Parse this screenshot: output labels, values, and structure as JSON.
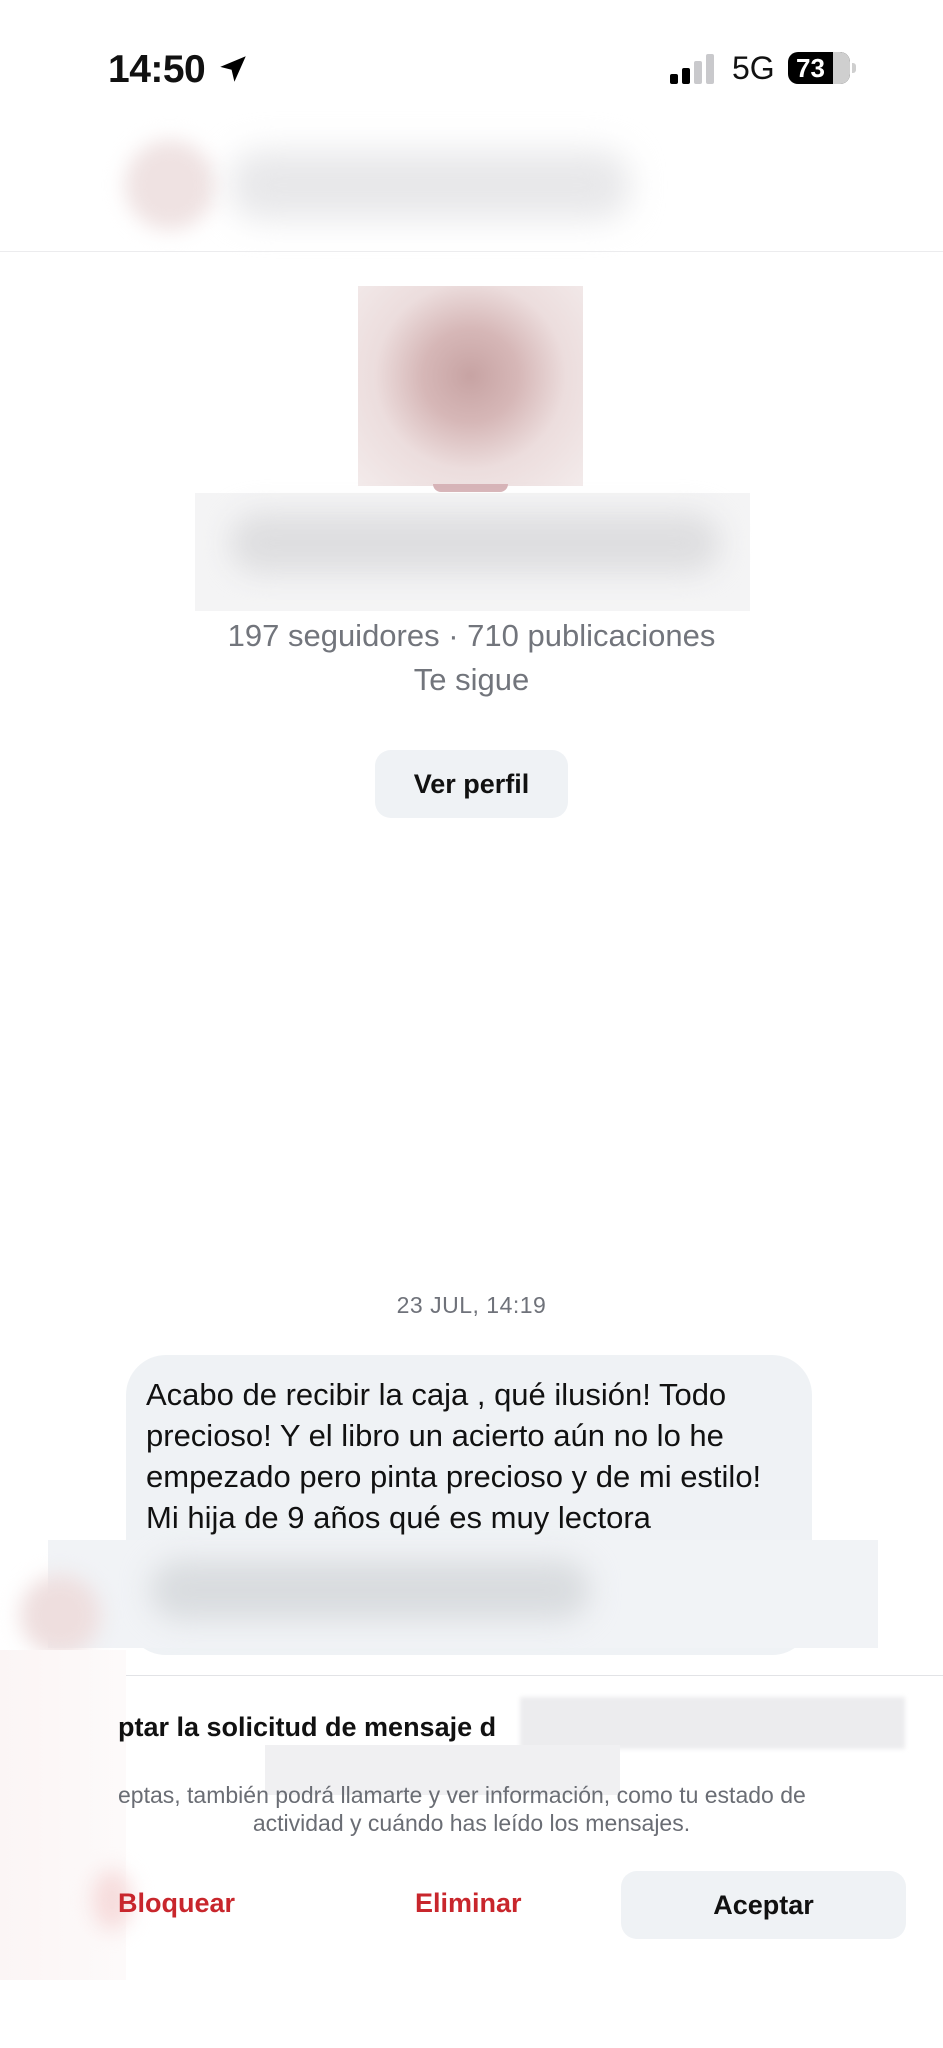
{
  "status_bar": {
    "time": "14:50",
    "network": "5G",
    "battery_level": "73",
    "location_icon": "location-arrow-icon"
  },
  "profile": {
    "stats": "197 seguidores · 710 publicaciones",
    "follows_you": "Te sigue",
    "view_profile_label": "Ver perfil"
  },
  "conversation": {
    "date": "23 JUL, 14:19",
    "message": "Acabo de recibir la caja , qué ilusión! Todo precioso! Y el libro un acierto aún no lo he empezado pero pinta precioso y de mi estilo! Mi hija de 9 años qué es muy lectora"
  },
  "request": {
    "title": "ptar la solicitud de mensaje d",
    "info_line1": "eptas, también podrá llamarte y ver información, como tu estado de",
    "info_line2": "actividad y cuándo has leído los mensajes.",
    "block_label": "Bloquear",
    "delete_label": "Eliminar",
    "accept_label": "Aceptar"
  },
  "colors": {
    "destructive": "#c8262c",
    "button_bg": "#eff2f5",
    "secondary_text": "#72757c"
  }
}
